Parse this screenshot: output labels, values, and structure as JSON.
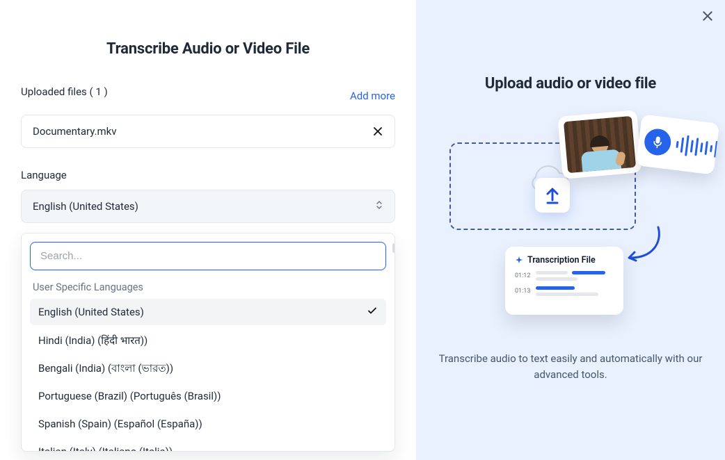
{
  "left": {
    "title": "Transcribe Audio or Video File",
    "uploaded_label": "Uploaded files ( 1 )",
    "add_more": "Add more",
    "file_name": "Documentary.mkv",
    "language_label": "Language",
    "selected_language": "English (United States)",
    "search_placeholder": "Search...",
    "group_label": "User Specific Languages",
    "options": [
      "English (United States)",
      "Hindi (India) (हिंदी भारत))",
      "Bengali (India) (বাংলা (ভারত))",
      "Portuguese (Brazil) (Português (Brasil))",
      "Spanish (Spain) (Español (España))",
      "Italian (Italy) (Italiano (Italia))"
    ],
    "selected_index": 0
  },
  "right": {
    "title": "Upload audio or video file",
    "transcription_card_title": "Transcription File",
    "t1": "01:12",
    "t2": "01:13",
    "desc": "Transcribe audio to text easily and automatically with our advanced tools."
  }
}
